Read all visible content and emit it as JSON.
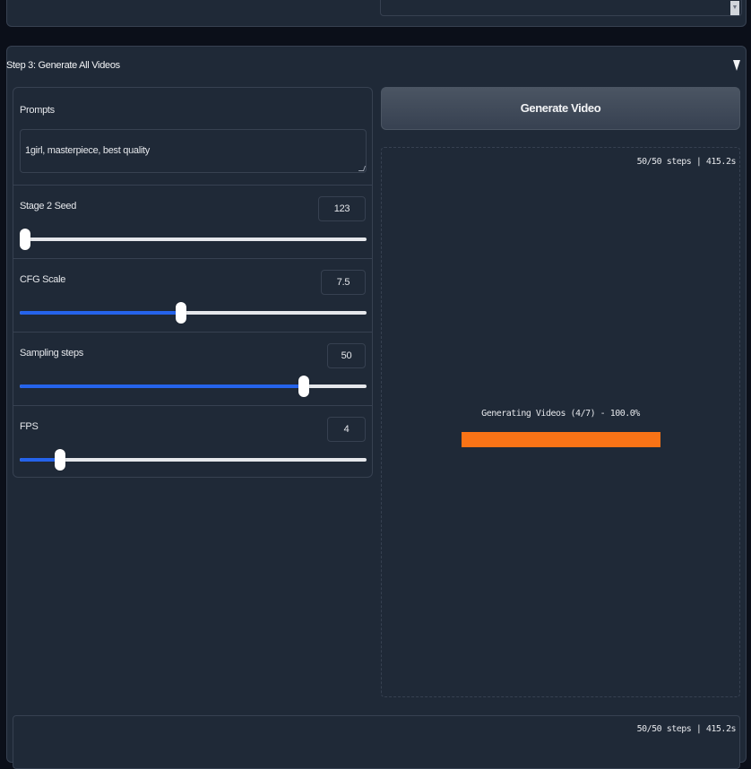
{
  "step3": {
    "title": "Step 3: Generate All Videos",
    "collapse_icon": "triangle-down-icon"
  },
  "prompts": {
    "label": "Prompts",
    "value": "1girl, masterpiece, best quality"
  },
  "sliders": [
    {
      "label": "Stage 2 Seed",
      "value": "123",
      "fraction": 0.0
    },
    {
      "label": "CFG Scale",
      "value": "7.5",
      "fraction": 0.465
    },
    {
      "label": "Sampling steps",
      "value": "50",
      "fraction": 0.82
    },
    {
      "label": "FPS",
      "value": "4",
      "fraction": 0.115
    }
  ],
  "generate": {
    "label": "Generate Video"
  },
  "output": {
    "timer": "50/50 steps | 415.2s",
    "progress_text": "Generating Videos (4/7) - 100.0%",
    "progress_fraction": 1.0,
    "progress_color": "#f97316"
  },
  "bottom": {
    "timer": "50/50 steps | 415.2s"
  },
  "colors": {
    "slider_fill": "#2563eb",
    "panel_bg": "#1f2937",
    "page_bg": "#0b0f19"
  }
}
